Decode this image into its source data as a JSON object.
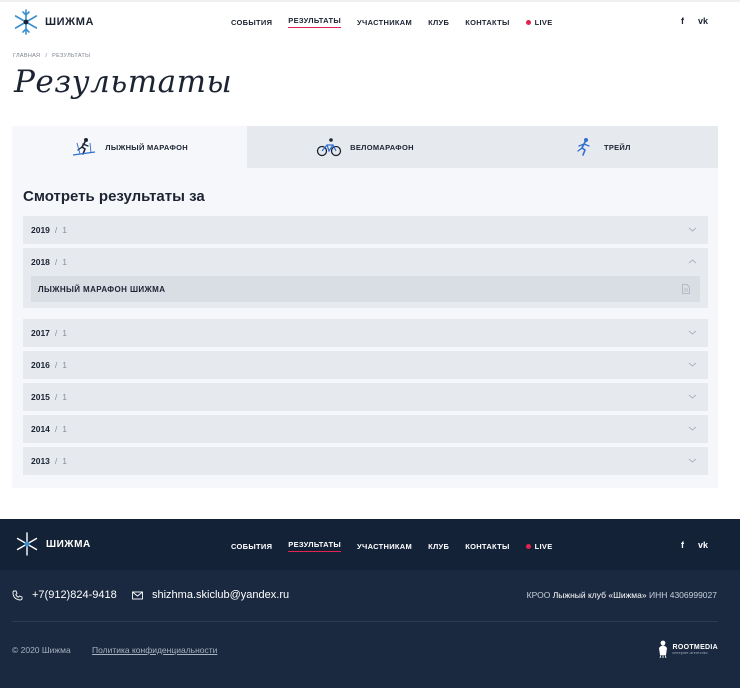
{
  "brand": {
    "name": "ШИЖМА",
    "accent": "#e0244f",
    "footer_bg": "#1a2940"
  },
  "nav": {
    "items": [
      "События",
      "Результаты",
      "Участникам",
      "Клуб",
      "Контакты"
    ],
    "live_label": "LIVE",
    "active_index": 1
  },
  "socials": {
    "facebook": "f",
    "vk": "vk"
  },
  "breadcrumb": {
    "home": "ГЛАВНАЯ",
    "separator": "/",
    "current": "РЕЗУЛЬТАТЫ"
  },
  "page_title": "Результаты",
  "tabs": [
    {
      "label": "Лыжный марафон",
      "icon": "skier-icon"
    },
    {
      "label": "Веломарафон",
      "icon": "bicycle-icon"
    },
    {
      "label": "Трейл",
      "icon": "runner-icon"
    }
  ],
  "section_title": "Смотреть результаты за",
  "years": [
    {
      "year": "2019",
      "count": "1",
      "open": false
    },
    {
      "year": "2018",
      "count": "1",
      "open": true,
      "docs": [
        "ЛЫЖНЫЙ МАРАФОН ШИЖМА"
      ]
    },
    {
      "year": "2017",
      "count": "1",
      "open": false
    },
    {
      "year": "2016",
      "count": "1",
      "open": false
    },
    {
      "year": "2015",
      "count": "1",
      "open": false
    },
    {
      "year": "2014",
      "count": "1",
      "open": false
    },
    {
      "year": "2013",
      "count": "1",
      "open": false
    }
  ],
  "footer": {
    "phone": "+7(912)824-9418",
    "email": "shizhma.skiclub@yandex.ru",
    "org_prefix": "КРОО",
    "org_name": "Лыжный клуб «Шижма»",
    "inn": "ИНН 4306999027",
    "copyright": "© 2020 Шижма",
    "policy": "Политика конфиденциальности",
    "developer": "ROOTMEDIA",
    "developer_sub": "интернет-агентство"
  }
}
